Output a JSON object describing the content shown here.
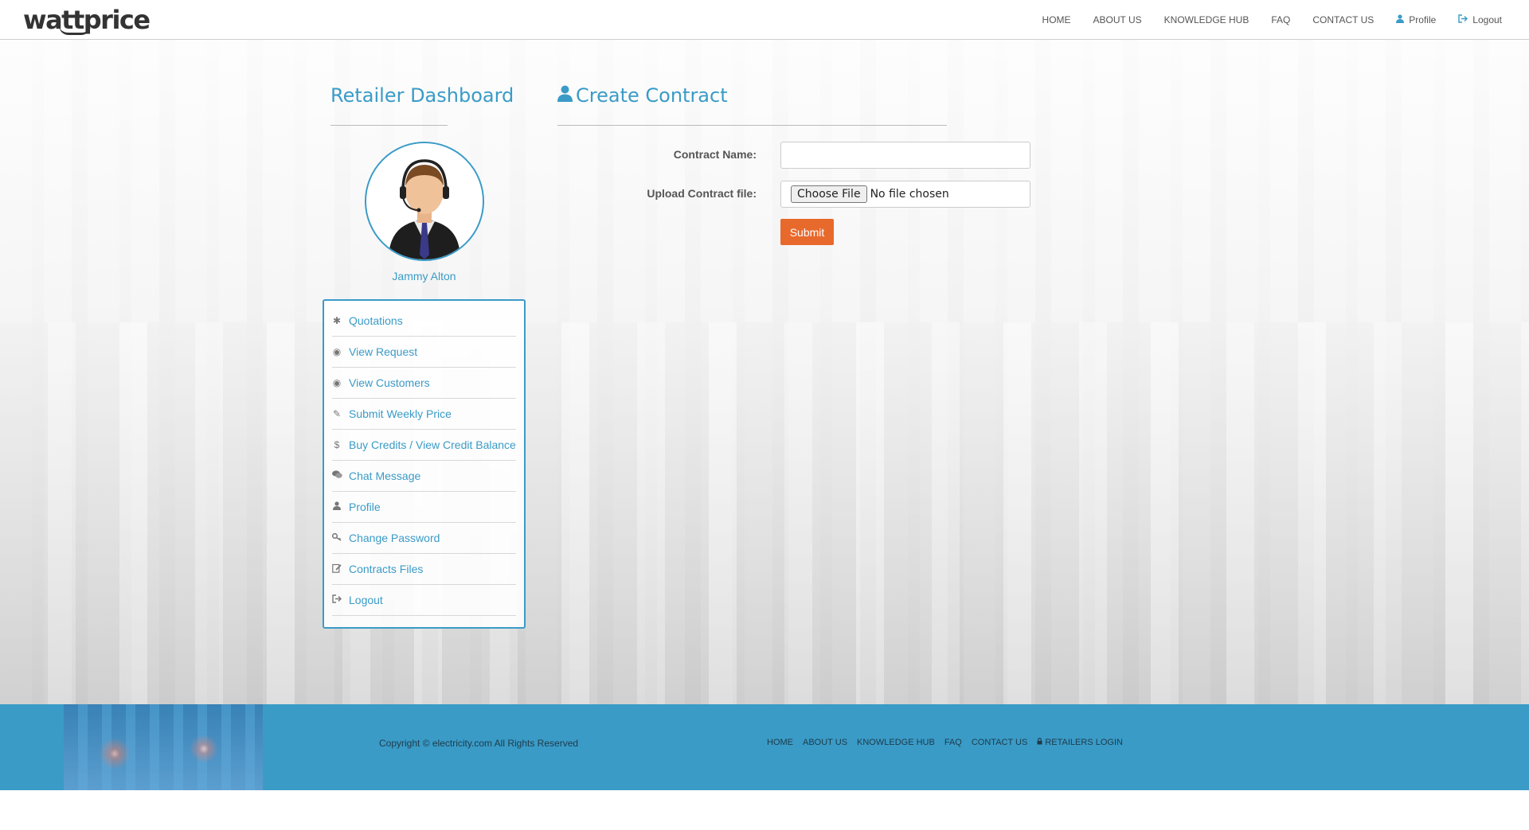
{
  "header": {
    "logo": "wattprice",
    "nav": [
      {
        "label": "HOME",
        "name": "nav-home"
      },
      {
        "label": "ABOUT US",
        "name": "nav-about-us"
      },
      {
        "label": "KNOWLEDGE HUB",
        "name": "nav-knowledge-hub"
      },
      {
        "label": "FAQ",
        "name": "nav-faq"
      },
      {
        "label": "CONTACT US",
        "name": "nav-contact-us"
      }
    ],
    "profile_label": "Profile",
    "logout_label": "Logout"
  },
  "sidebar": {
    "title": "Retailer Dashboard",
    "user_name": "Jammy Alton",
    "items": [
      {
        "label": "Quotations",
        "icon": "asterisk-icon",
        "glyph": "✱"
      },
      {
        "label": "View Request",
        "icon": "eye-icon",
        "glyph": "◉"
      },
      {
        "label": "View Customers",
        "icon": "eye-icon",
        "glyph": "◉"
      },
      {
        "label": "Submit Weekly Price",
        "icon": "pencil-icon",
        "glyph": "✎"
      },
      {
        "label": "Buy Credits / View Credit Balance",
        "icon": "dollar-icon",
        "glyph": "$"
      },
      {
        "label": "Chat Message",
        "icon": "comments-icon",
        "glyph": "💬"
      },
      {
        "label": "Profile",
        "icon": "user-icon",
        "glyph": "👤"
      },
      {
        "label": "Change Password",
        "icon": "key-icon",
        "glyph": "⚷"
      },
      {
        "label": "Contracts Files",
        "icon": "edit-file-icon",
        "glyph": "✍"
      },
      {
        "label": "Logout",
        "icon": "logout-icon",
        "glyph": "⇥"
      }
    ]
  },
  "form": {
    "title": "Create Contract",
    "contract_name_label": "Contract Name:",
    "contract_name_value": "",
    "upload_label": "Upload Contract file:",
    "choose_file_label": "Choose File",
    "file_status": "No file chosen",
    "submit_label": "Submit"
  },
  "footer": {
    "copyright": "Copyright © electricity.com All Rights Reserved",
    "links": [
      "HOME",
      "ABOUT US",
      "KNOWLEDGE HUB",
      "FAQ",
      "CONTACT US"
    ],
    "retailers_login": "RETAILERS LOGIN"
  },
  "colors": {
    "accent": "#3a9bc7",
    "submit": "#e8692c",
    "footer_bg": "#3a9bc7"
  }
}
